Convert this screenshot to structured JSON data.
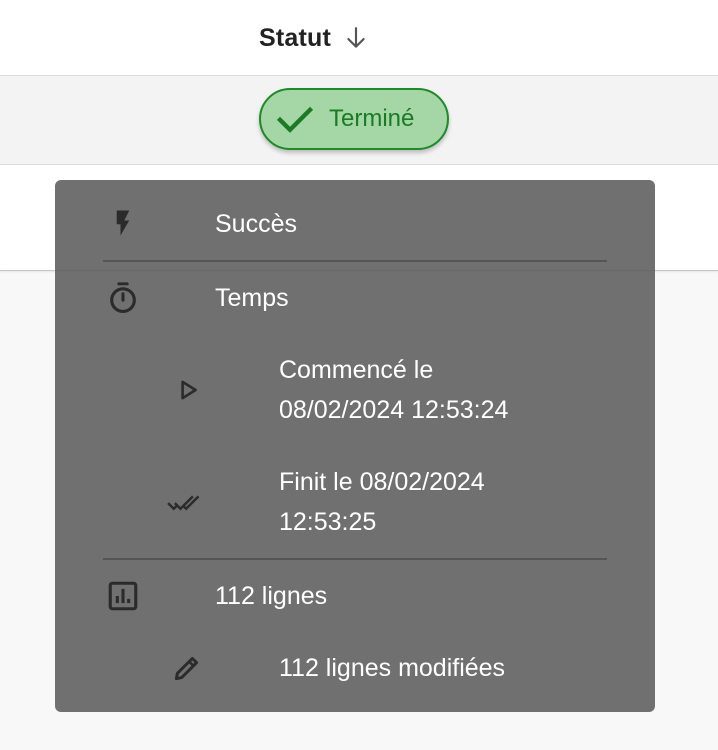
{
  "table": {
    "column_header": "Statut",
    "sort_icon": "arrow-down-icon",
    "status_chip": {
      "label": "Terminé",
      "icon": "check-icon",
      "color": "#1b7a26",
      "background": "#a5d6a5"
    }
  },
  "tooltip": {
    "background": "#616161",
    "success": {
      "icon": "flash-icon",
      "label": "Succès"
    },
    "time": {
      "icon": "timer-icon",
      "label": "Temps"
    },
    "started": {
      "icon": "play-outline-icon",
      "line1": "Commencé le",
      "line2": "08/02/2024 12:53:24"
    },
    "finished": {
      "icon": "double-check-icon",
      "line1": "Finit le 08/02/2024",
      "line2": "12:53:25"
    },
    "rows": {
      "icon": "chart-box-icon",
      "label": "112 lignes"
    },
    "modified": {
      "icon": "pencil-icon",
      "label": "112 lignes modifiées"
    }
  }
}
